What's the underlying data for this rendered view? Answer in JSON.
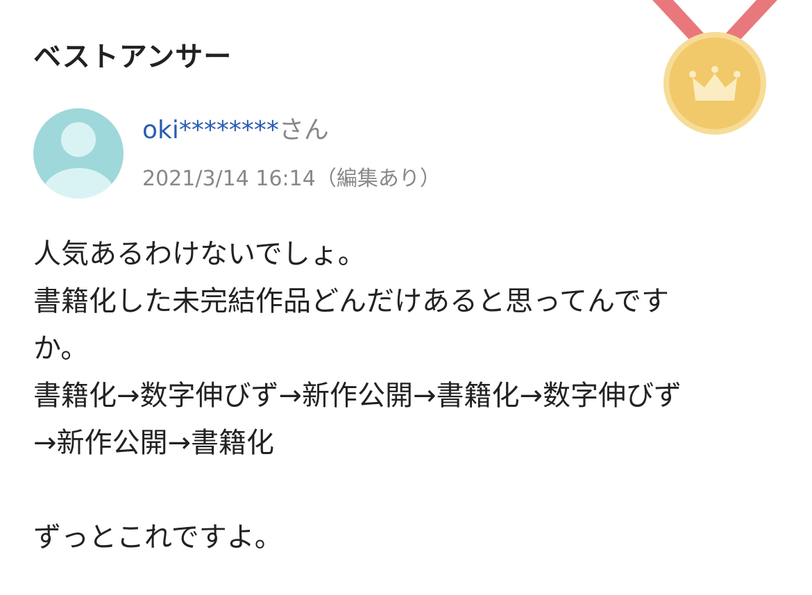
{
  "header": {
    "title": "ベストアンサー"
  },
  "badge": {
    "icon": "medal-crown-icon",
    "ribbon_color": "#e8787c",
    "medal_color": "#f1c96a",
    "medal_rim_color": "#f5d98e",
    "crown_color": "#fbecc2"
  },
  "answer": {
    "avatar_icon": "user-avatar-icon",
    "avatar_color": "#9fd8da",
    "username": "oki********",
    "honorific": "さん",
    "meta": "2021/3/14 16:14（編集あり）",
    "body_lines": [
      "人気あるわけないでしょ。",
      "書籍化した未完結作品どんだけあると思ってんです",
      "か。",
      "書籍化→数字伸びず→新作公開→書籍化→数字伸びず",
      "→新作公開→書籍化",
      "",
      "ずっとこれですよ。"
    ]
  },
  "colors": {
    "username": "#2a5db0",
    "meta": "#888888",
    "text": "#222222"
  }
}
